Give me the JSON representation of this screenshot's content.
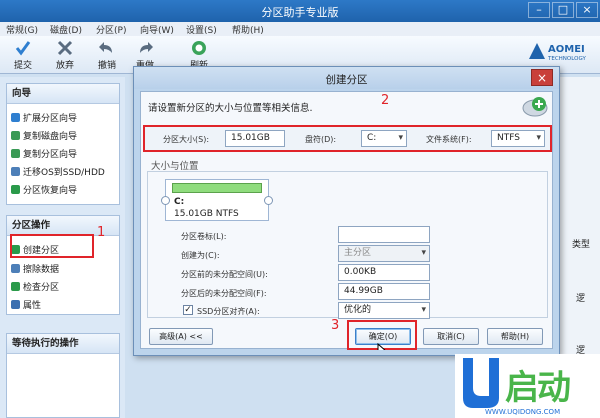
{
  "window": {
    "title": "分区助手专业版"
  },
  "menu": [
    "常规(G)",
    "磁盘(D)",
    "分区(P)",
    "向导(W)",
    "设置(S)",
    "帮助(H)"
  ],
  "toolbar": {
    "items": [
      {
        "label": "提交",
        "icon": "check-icon",
        "color": "#2f7fd0"
      },
      {
        "label": "放弃",
        "icon": "x-icon",
        "color": "#5a6c80"
      },
      {
        "label": "撤销",
        "icon": "undo-icon",
        "color": "#5a6c80"
      },
      {
        "label": "重做",
        "icon": "redo-icon",
        "color": "#5a6c80"
      },
      {
        "label": "刷新",
        "icon": "refresh-icon",
        "color": "#2a9a4a"
      }
    ],
    "logo_main": "AOMEI",
    "logo_sub": "TECHNOLOGY"
  },
  "sidebar": {
    "wizard": {
      "title": "向导",
      "items": [
        "扩展分区向导",
        "复制磁盘向导",
        "复制分区向导",
        "迁移OS到SSD/HDD",
        "分区恢复向导"
      ]
    },
    "ops": {
      "title": "分区操作",
      "items": [
        "创建分区",
        "擦除数据",
        "检查分区",
        "属性"
      ]
    },
    "pending": {
      "title": "等待执行的操作"
    }
  },
  "right_strip": {
    "col1": "类型",
    "row1": "逻",
    "row2": "逻",
    "row3": "逻"
  },
  "dialog": {
    "title": "创建分区",
    "instruction": "请设置新分区的大小与位置等相关信息.",
    "size_label": "分区大小(S):",
    "size_value": "15.01GB",
    "drive_label": "盘符(D):",
    "drive_value": "C:",
    "fs_label": "文件系统(F):",
    "fs_value": "NTFS",
    "section_title": "大小与位置",
    "partition_card": {
      "name": "C:",
      "info": "15.01GB NTFS"
    },
    "advanced": {
      "label_field": "分区卷标(L):",
      "label_value": "",
      "create_as": "创建为(C):",
      "create_as_value": "主分区",
      "before_space": "分区前的未分配空间(U):",
      "before_value": "0.00KB",
      "after_space": "分区后的未分配空间(F):",
      "after_value": "44.99GB",
      "ssd_align": "SSD分区对齐(A):",
      "ssd_value": "优化的",
      "ssd_checked": true
    },
    "buttons": {
      "advanced": "高级(A) <<",
      "ok": "确定(O)",
      "cancel": "取消(C)",
      "help": "帮助(H)"
    }
  },
  "annotations": {
    "a1": "1",
    "a2": "2",
    "a3": "3"
  },
  "brand": {
    "logo": "U启动",
    "url": "WWW.UQIDONG.COM"
  },
  "colors": {
    "accent": "#2d79c7",
    "annotation_red": "#e0242a",
    "brand_blue": "#1f6fd6",
    "brand_green": "#49b54a"
  }
}
